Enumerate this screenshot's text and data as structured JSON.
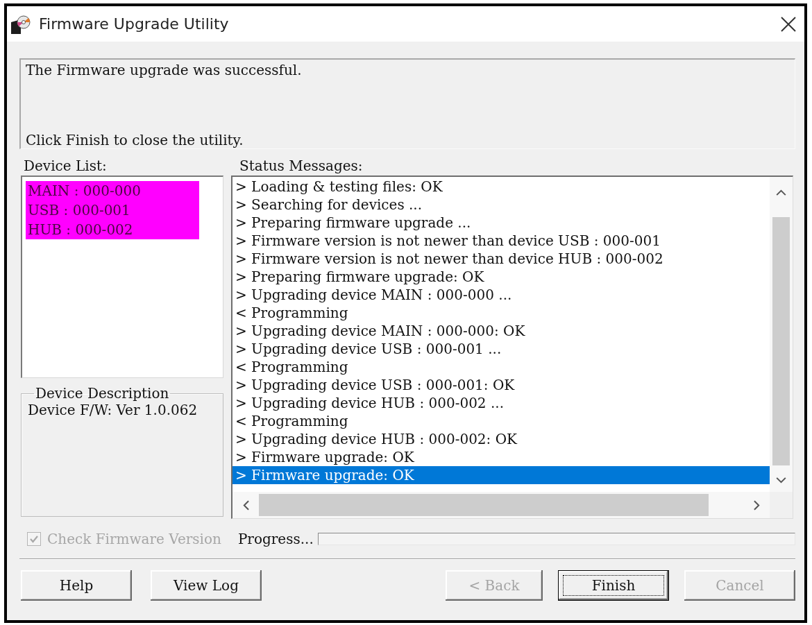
{
  "window": {
    "title": "Firmware Upgrade Utility"
  },
  "message": {
    "lines": [
      "The Firmware upgrade was successful.",
      "Click Finish to close the utility."
    ]
  },
  "device_list": {
    "label": "Device List:",
    "items": [
      {
        "text": "MAIN : 000-000",
        "selected": true
      },
      {
        "text": "USB : 000-001",
        "selected": true
      },
      {
        "text": "HUB : 000-002",
        "selected": true
      }
    ]
  },
  "device_description": {
    "title": "Device Description",
    "text": "Device F/W: Ver 1.0.062"
  },
  "status_messages": {
    "label": "Status Messages:",
    "lines": [
      {
        "text": "> Loading & testing files: OK",
        "selected": false
      },
      {
        "text": "> Searching for devices ...",
        "selected": false
      },
      {
        "text": "> Preparing firmware upgrade ...",
        "selected": false
      },
      {
        "text": "> Firmware version is not newer than device USB : 000-001",
        "selected": false
      },
      {
        "text": "> Firmware version is not newer than device HUB : 000-002",
        "selected": false
      },
      {
        "text": "> Preparing firmware upgrade: OK",
        "selected": false
      },
      {
        "text": "> Upgrading device MAIN : 000-000 ...",
        "selected": false
      },
      {
        "text": "< Programming",
        "selected": false
      },
      {
        "text": "> Upgrading device MAIN : 000-000: OK",
        "selected": false
      },
      {
        "text": "> Upgrading device USB : 000-001 ...",
        "selected": false
      },
      {
        "text": "< Programming",
        "selected": false
      },
      {
        "text": "> Upgrading device USB : 000-001: OK",
        "selected": false
      },
      {
        "text": "> Upgrading device HUB : 000-002 ...",
        "selected": false
      },
      {
        "text": "< Programming",
        "selected": false
      },
      {
        "text": "> Upgrading device HUB : 000-002: OK",
        "selected": false
      },
      {
        "text": "> Firmware upgrade: OK",
        "selected": false
      },
      {
        "text": "> Firmware upgrade: OK",
        "selected": true
      }
    ]
  },
  "check_firmware_version": {
    "label": "Check Firmware Version",
    "checked": true,
    "disabled": true
  },
  "progress": {
    "label": "Progress...",
    "level": 0
  },
  "buttons": {
    "left": [
      {
        "label": "Help",
        "disabled": false,
        "focused": false
      },
      {
        "label": "View Log",
        "disabled": false,
        "focused": false
      }
    ],
    "right": [
      {
        "label": "< Back",
        "disabled": true,
        "focused": false
      },
      {
        "label": "Finish",
        "disabled": false,
        "focused": true
      },
      {
        "label": "Cancel",
        "disabled": true,
        "focused": false
      }
    ]
  }
}
